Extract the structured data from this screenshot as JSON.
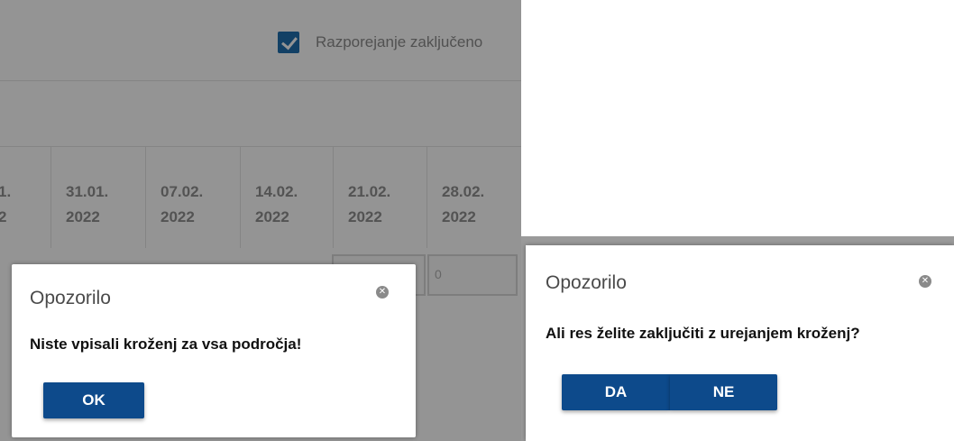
{
  "app": {
    "checkbox_label": "Razporejanje zaključeno",
    "date_columns": [
      {
        "line1": "1.",
        "line2": "2"
      },
      {
        "line1": "31.01.",
        "line2": "2022"
      },
      {
        "line1": "07.02.",
        "line2": "2022"
      },
      {
        "line1": "14.02.",
        "line2": "2022"
      },
      {
        "line1": "21.02.",
        "line2": "2022"
      },
      {
        "line1": "28.02.",
        "line2": "2022"
      }
    ],
    "cell_value": "0"
  },
  "dialog_left": {
    "title": "Opozorilo",
    "close_glyph": "✕",
    "message": "Niste vpisali kroženj za vsa področja!",
    "ok_label": "OK"
  },
  "dialog_right": {
    "title": "Opozorilo",
    "close_glyph": "✕",
    "message": "Ali res želite zaključiti z urejanjem kroženj?",
    "yes_label": "DA",
    "no_label": "NE"
  },
  "colors": {
    "button_bg": "#0d4a8b",
    "checkbox_bg": "#1f6fae",
    "overlay": "rgba(0,0,0,0.42)"
  }
}
